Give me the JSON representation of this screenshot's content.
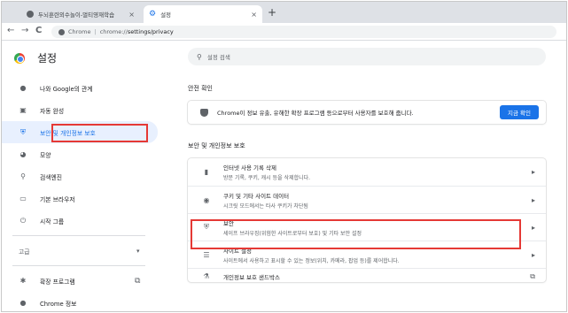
{
  "browser": {
    "tabs": [
      {
        "title": "두뇌훈련외수놀이-멀티영재학습",
        "close": "×",
        "active": false
      },
      {
        "title": "설정",
        "close": "×",
        "active": true
      }
    ],
    "new_tab": "+",
    "back": "←",
    "forward": "→",
    "reload": "C",
    "omnibox": {
      "host_label": "Chrome",
      "separator": "|",
      "url_host": "chrome://",
      "url_path": "settings/privacy"
    }
  },
  "settings": {
    "title": "설정",
    "search_placeholder": "설정 검색",
    "nav": [
      {
        "label": "나와 Google의 관계",
        "icon": "person-icon"
      },
      {
        "label": "자동 완성",
        "icon": "clipboard-icon"
      },
      {
        "label": "보안 및 개인정보 보호",
        "icon": "shield-icon",
        "active": true
      },
      {
        "label": "모양",
        "icon": "palette-icon"
      },
      {
        "label": "검색엔진",
        "icon": "search-icon"
      },
      {
        "label": "기본 브라우저",
        "icon": "browser-icon"
      },
      {
        "label": "시작 그룹",
        "icon": "power-icon"
      }
    ],
    "advanced": {
      "label": "고급",
      "chevron": "▾"
    },
    "extensions": {
      "label": "확장 프로그램",
      "icon": "puzzle-icon",
      "ext_icon": "open-in-new-icon"
    },
    "about": {
      "label": "Chrome 정보"
    },
    "safety_check": {
      "heading": "안전 확인",
      "text": "Chrome이 정보 유출, 유해한 확장 프로그램 등으로부터 사용자를 보호해 줍니다.",
      "button": "지금 확인"
    },
    "privacy": {
      "heading": "보안 및 개인정보 보호",
      "rows": [
        {
          "title": "인터넷 사용 기록 삭제",
          "subtitle": "방문 기록, 쿠키, 캐시 등을 삭제합니다.",
          "icon": "trash-icon"
        },
        {
          "title": "쿠키 및 기타 사이트 데이터",
          "subtitle": "시크릿 모드에서는 타사 쿠키가 차단됨",
          "icon": "cookie-icon"
        },
        {
          "title": "보안",
          "subtitle": "세이프 브라우징(위험한 사이트로부터 보호) 및 기타 보안 설정",
          "icon": "security-shield-icon"
        },
        {
          "title": "사이트 설정",
          "subtitle": "사이트에서 사용하고 표시할 수 있는 정보(위치, 카메라, 팝업 등)를 제어합니다.",
          "icon": "tune-icon"
        },
        {
          "title": "개인정보 보호 샌드박스",
          "subtitle": "",
          "icon": "flask-icon"
        }
      ]
    }
  },
  "colors": {
    "accent": "#1a73e8",
    "highlight_border": "#e53935"
  }
}
